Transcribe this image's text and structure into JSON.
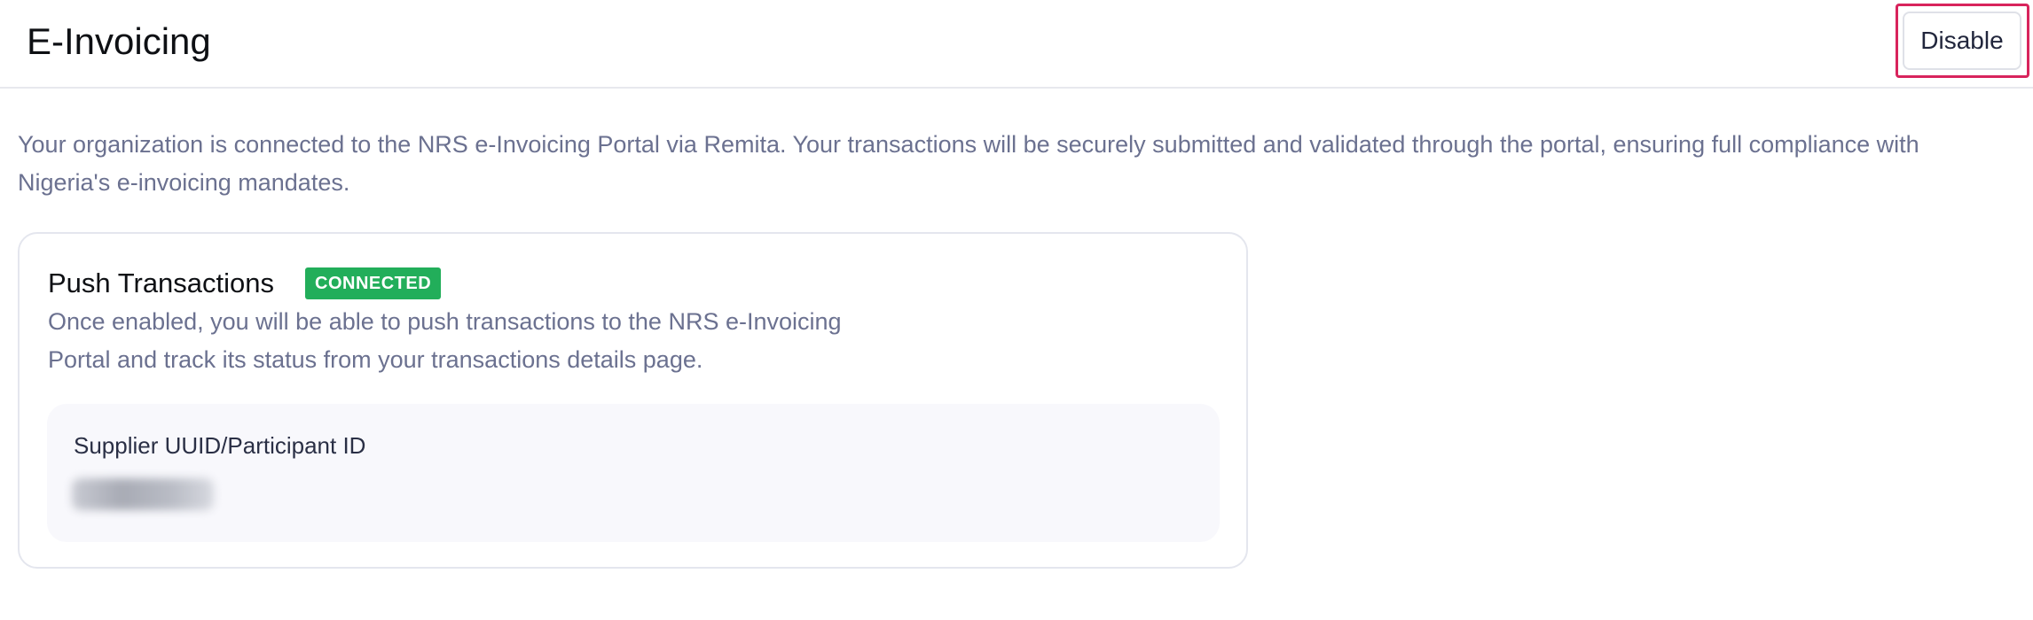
{
  "header": {
    "title": "E-Invoicing",
    "disable_label": "Disable"
  },
  "description": "Your organization is connected to the NRS e-Invoicing Portal via Remita. Your transactions will be securely submitted and validated through the portal, ensuring full compliance with Nigeria's e-invoicing mandates.",
  "card": {
    "title": "Push Transactions",
    "status": "CONNECTED",
    "status_color": "#22ae5a",
    "description_line1": "Once enabled, you will be able to push transactions to the NRS e-Invoicing",
    "description_line2": "Portal and track its status from your transactions details page.",
    "field": {
      "label": "Supplier UUID/Participant ID"
    }
  },
  "colors": {
    "highlight": "#d8245c",
    "muted_text": "#6b7190"
  }
}
